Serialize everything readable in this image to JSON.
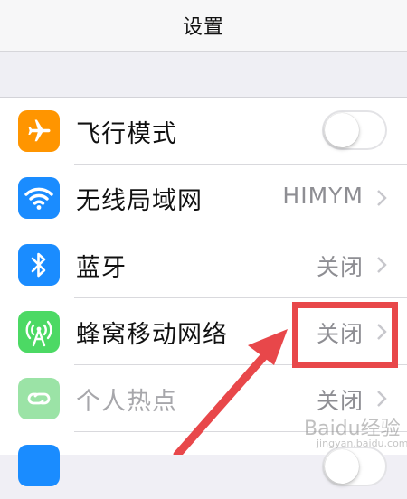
{
  "navbar": {
    "title": "设置"
  },
  "settings": {
    "airplane": {
      "label": "飞行模式",
      "toggle_on": false,
      "icon": "airplane-icon",
      "color": "#ff9500"
    },
    "wifi": {
      "label": "无线局域网",
      "value": "HIMYM",
      "icon": "wifi-icon",
      "color": "#1a8cff"
    },
    "bluetooth": {
      "label": "蓝牙",
      "value": "关闭",
      "icon": "bluetooth-icon",
      "color": "#1a8cff"
    },
    "cellular": {
      "label": "蜂窝移动网络",
      "value": "关闭",
      "icon": "cellular-antenna-icon",
      "color": "#4cd964"
    },
    "hotspot": {
      "label": "个人热点",
      "value": "关闭",
      "icon": "hotspot-link-icon",
      "color": "#9be3a6"
    }
  },
  "annotation": {
    "highlight_color": "#e8474a"
  },
  "watermark": {
    "text": "Baidu经验",
    "sub": "jingyan.baidu.com"
  }
}
